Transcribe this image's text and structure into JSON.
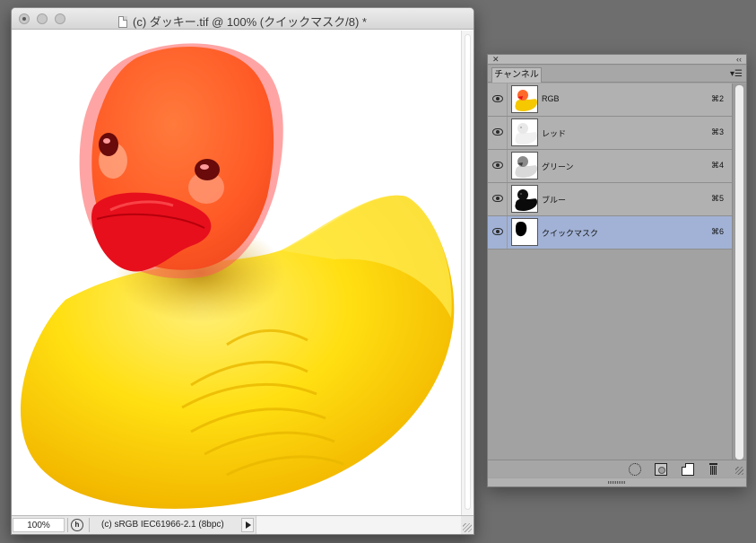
{
  "document": {
    "title": "(c) ダッキー.tif @ 100% (クイックマスク/8) *",
    "zoom": "100%",
    "color_profile": "(c) sRGB IEC61966-2.1 (8bpc)",
    "image_content": "rubber-duck-with-quick-mask-overlay-on-head"
  },
  "channels_panel": {
    "tab_label": "チャンネル",
    "close_icon": "close-icon",
    "collapse_icon": "collapse-icon",
    "menu_icon": "panel-menu-icon",
    "selected_color": "#a2b2d6",
    "channels": [
      {
        "name": "RGB",
        "shortcut": "⌘2",
        "visible": true,
        "selected": false
      },
      {
        "name": "レッド",
        "shortcut": "⌘3",
        "visible": true,
        "selected": false
      },
      {
        "name": "グリーン",
        "shortcut": "⌘4",
        "visible": true,
        "selected": false
      },
      {
        "name": "ブルー",
        "shortcut": "⌘5",
        "visible": true,
        "selected": false
      },
      {
        "name": "クイックマスク",
        "shortcut": "⌘6",
        "visible": true,
        "selected": true
      }
    ],
    "footer_icons": [
      "load-selection-icon",
      "save-selection-icon",
      "new-channel-icon",
      "trash-icon"
    ]
  }
}
